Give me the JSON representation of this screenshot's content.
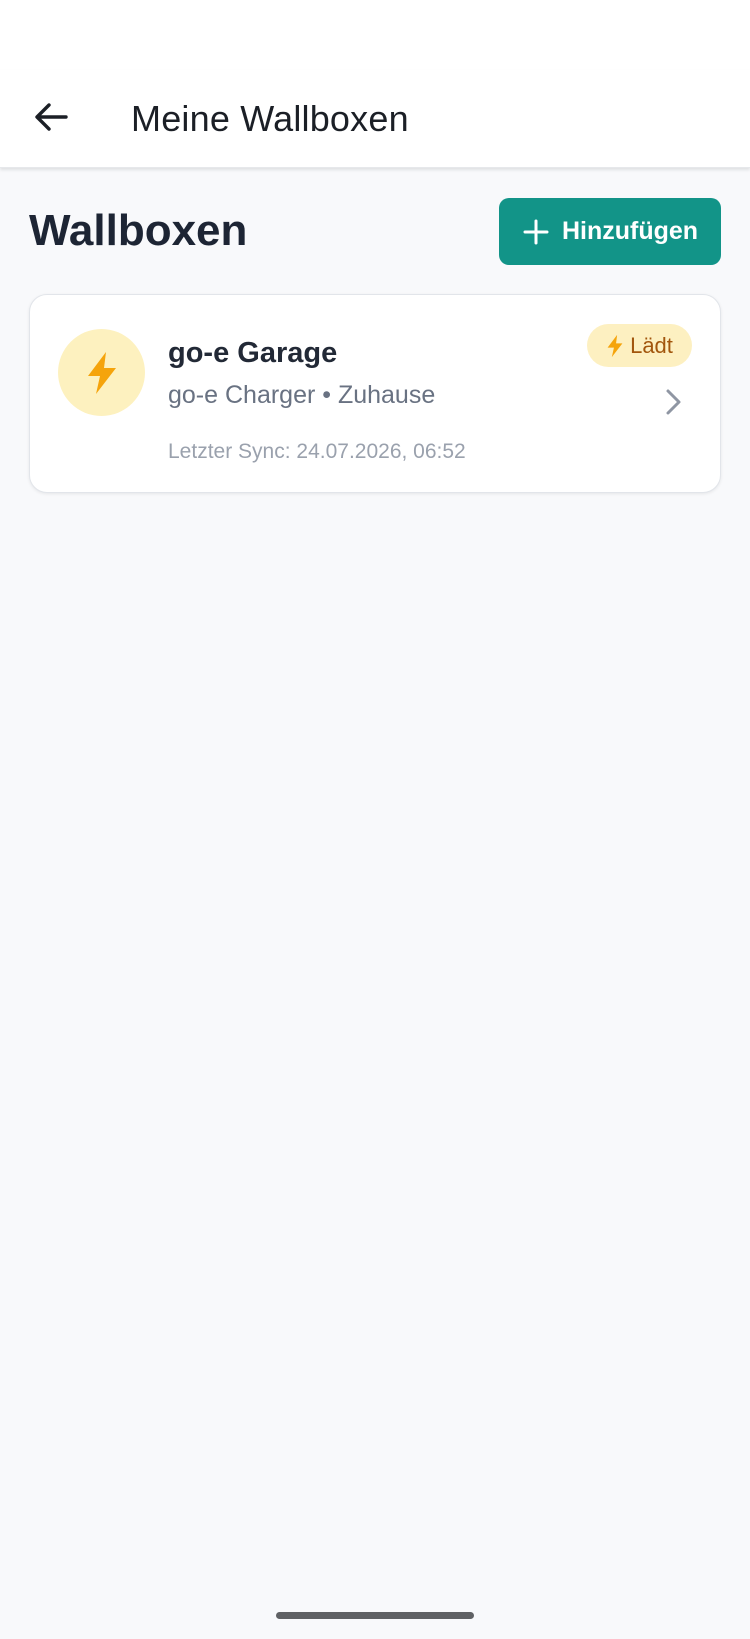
{
  "app_bar": {
    "title": "Meine Wallboxen",
    "back_icon": "arrow-left-icon"
  },
  "section": {
    "title": "Wallboxen",
    "add_button_label": "Hinzufügen",
    "add_icon": "plus-icon"
  },
  "wallboxes": [
    {
      "name": "go-e Garage",
      "subtitle": "go-e Charger • Zuhause",
      "last_sync": "Letzter Sync: 24.07.2026, 06:52",
      "status": "Lädt",
      "icon": "lightning-bolt-icon",
      "status_icon": "lightning-bolt-icon",
      "nav_icon": "chevron-right-icon"
    }
  ],
  "colors": {
    "accent": "#129488",
    "background": "#f8f9fb",
    "status_bg": "#fdf0c1",
    "status_text": "#a2560d",
    "bolt": "#f5a40c",
    "avatar_bg": "#fdf1bf"
  }
}
